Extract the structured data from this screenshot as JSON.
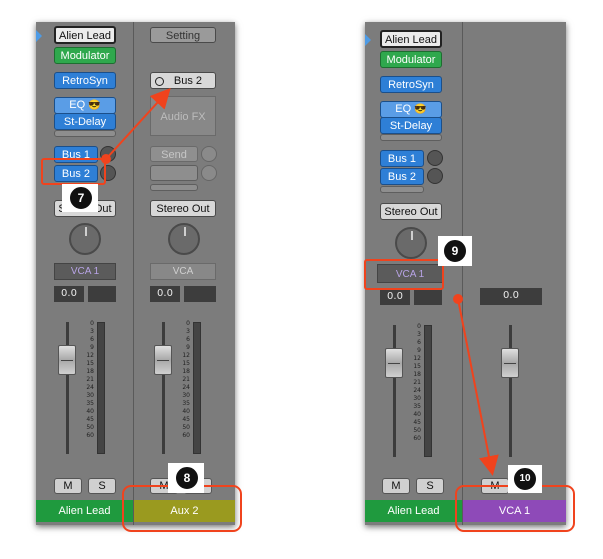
{
  "left_mixer": {
    "strip1": {
      "top_label": "Alien Lead",
      "modulator": "Modulator",
      "plugins": [
        "RetroSyn",
        "EQ",
        "St-Delay"
      ],
      "sends": [
        "Bus 1",
        "Bus 2"
      ],
      "output": "Stereo Out",
      "vca": "VCA 1",
      "gain": "0.0",
      "mute": "M",
      "solo": "S",
      "name": "Alien Lead",
      "name_color": "#1f9a3e"
    },
    "strip2": {
      "setting": "Setting",
      "input": "Bus 2",
      "audio_fx": "Audio FX",
      "send": "Send",
      "output": "Stereo Out",
      "vca": "VCA",
      "gain": "0.0",
      "mute": "M",
      "solo": "S",
      "name": "Aux 2",
      "name_color": "#9a9a1f"
    }
  },
  "right_mixer": {
    "strip1": {
      "top_label": "Alien Lead",
      "modulator": "Modulator",
      "plugins": [
        "RetroSyn",
        "EQ",
        "St-Delay"
      ],
      "sends": [
        "Bus 1",
        "Bus 2"
      ],
      "output": "Stereo Out",
      "vca": "VCA 1",
      "gain": "0.0",
      "mute": "M",
      "solo": "S",
      "name": "Alien Lead",
      "name_color": "#1f9a3e"
    },
    "strip2": {
      "gain": "0.0",
      "mute": "M",
      "name": "VCA 1",
      "name_color": "#8e4ab8"
    }
  },
  "meter_scale": [
    "0",
    "3",
    "6",
    "9",
    "12",
    "15",
    "18",
    "21",
    "24",
    "",
    "30",
    "35",
    "40",
    "45",
    "50",
    "60"
  ],
  "callouts": {
    "step7": "7",
    "step8": "8",
    "step9": "9",
    "step10": "10"
  },
  "accent_color": "#f0431d"
}
